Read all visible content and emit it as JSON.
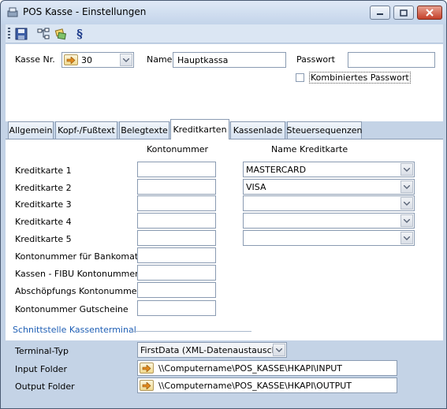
{
  "window": {
    "title": "POS Kasse - Einstellungen"
  },
  "toolbar": {
    "buttons": [
      "save-icon",
      "tree-icon",
      "transfer-icon",
      "paragraph-icon"
    ],
    "paragraph_glyph": "§"
  },
  "header": {
    "kasse_nr_label": "Kasse Nr.",
    "kasse_nr_value": "30",
    "name_label": "Name",
    "name_value": "Hauptkassa",
    "passwort_label": "Passwort",
    "passwort_value": "",
    "kombiniert_label": "Kombiniertes Passwort",
    "kombiniert_checked": false
  },
  "tabs": [
    {
      "label": "Allgemein",
      "active": false
    },
    {
      "label": "Kopf-/Fußtext",
      "active": false
    },
    {
      "label": "Belegtexte",
      "active": false
    },
    {
      "label": "Kreditkarten",
      "active": true
    },
    {
      "label": "Kassenlade",
      "active": false
    },
    {
      "label": "Steuersequenzen",
      "active": false
    }
  ],
  "kreditkarten": {
    "col_kontonummer": "Kontonummer",
    "col_name": "Name Kreditkarte",
    "cards": [
      {
        "label": "Kreditkarte 1",
        "konto": "",
        "name": "MASTERCARD"
      },
      {
        "label": "Kreditkarte 2",
        "konto": "",
        "name": "VISA"
      },
      {
        "label": "Kreditkarte 3",
        "konto": "",
        "name": ""
      },
      {
        "label": "Kreditkarte 4",
        "konto": "",
        "name": ""
      },
      {
        "label": "Kreditkarte 5",
        "konto": "",
        "name": ""
      }
    ],
    "extra_rows": [
      {
        "label": "Kontonummer für Bankomat",
        "value": ""
      },
      {
        "label": "Kassen - FIBU Kontonummer",
        "value": ""
      },
      {
        "label": "Abschöpfungs Kontonummer",
        "value": ""
      },
      {
        "label": "Kontonummer Gutscheine",
        "value": ""
      }
    ]
  },
  "terminal": {
    "group_title": "Schnittstelle Kassenterminal",
    "typ_label": "Terminal-Typ",
    "typ_value": "FirstData (XML-Datenaustausch)",
    "input_label": "Input Folder",
    "input_value": "\\\\Computername\\POS_KASSE\\HKAPI\\INPUT",
    "output_label": "Output Folder",
    "output_value": "\\\\Computername\\POS_KASSE\\HKAPI\\OUTPUT"
  },
  "colors": {
    "frame": "#c4d3e6",
    "group_title": "#1f5fb5",
    "arrow_button": "#f1d98e"
  }
}
